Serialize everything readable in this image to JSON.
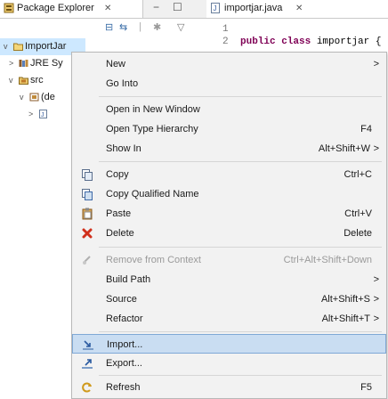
{
  "tabs": {
    "package_explorer": "Package Explorer",
    "close": "✕",
    "minimize": "−",
    "maximize": "☐",
    "editor_file": "importjar.java",
    "editor_close": "✕"
  },
  "view_toolbar": {
    "collapse": "⊟",
    "link": "⇆",
    "separator": "|",
    "focus": "✱",
    "dropdown": "▽"
  },
  "tree": [
    {
      "twisty": "v",
      "label": "ImportJar"
    },
    {
      "twisty": ">",
      "label": "JRE Sy"
    },
    {
      "twisty": "v",
      "label": "src"
    },
    {
      "twisty": "v",
      "label": "(de"
    },
    {
      "twisty": ">",
      "label": ""
    }
  ],
  "editor": {
    "lines": [
      {
        "num": "1",
        "code": ""
      },
      {
        "num": "2",
        "keyword": "public class",
        "rest": " importjar {"
      }
    ]
  },
  "menu": {
    "items": [
      {
        "label": "New",
        "accel": "",
        "submenu": true,
        "disabled": false,
        "icon": ""
      },
      {
        "label": "Go Into",
        "accel": "",
        "submenu": false,
        "disabled": false,
        "icon": ""
      },
      {
        "label": "Open in New Window",
        "accel": "",
        "submenu": false,
        "disabled": false,
        "icon": ""
      },
      {
        "label": "Open Type Hierarchy",
        "accel": "F4",
        "submenu": false,
        "disabled": false,
        "icon": ""
      },
      {
        "label": "Show In",
        "accel": "Alt+Shift+W",
        "submenu": true,
        "disabled": false,
        "icon": ""
      },
      {
        "label": "Copy",
        "accel": "Ctrl+C",
        "submenu": false,
        "disabled": false,
        "icon": "copy-icon"
      },
      {
        "label": "Copy Qualified Name",
        "accel": "",
        "submenu": false,
        "disabled": false,
        "icon": "copy-qualified-name-icon"
      },
      {
        "label": "Paste",
        "accel": "Ctrl+V",
        "submenu": false,
        "disabled": false,
        "icon": "paste-icon"
      },
      {
        "label": "Delete",
        "accel": "Delete",
        "submenu": false,
        "disabled": false,
        "icon": "delete-icon"
      },
      {
        "label": "Remove from Context",
        "accel": "Ctrl+Alt+Shift+Down",
        "submenu": false,
        "disabled": true,
        "icon": "remove-from-context-icon"
      },
      {
        "label": "Build Path",
        "accel": "",
        "submenu": true,
        "disabled": false,
        "icon": ""
      },
      {
        "label": "Source",
        "accel": "Alt+Shift+S",
        "submenu": true,
        "disabled": false,
        "icon": ""
      },
      {
        "label": "Refactor",
        "accel": "Alt+Shift+T",
        "submenu": true,
        "disabled": false,
        "icon": ""
      },
      {
        "label": "Import...",
        "accel": "",
        "submenu": false,
        "disabled": false,
        "icon": "import-icon",
        "highlighted": true
      },
      {
        "label": "Export...",
        "accel": "",
        "submenu": false,
        "disabled": false,
        "icon": "export-icon"
      },
      {
        "label": "Refresh",
        "accel": "F5",
        "submenu": false,
        "disabled": false,
        "icon": "refresh-icon"
      }
    ],
    "submenu_arrow": ">"
  },
  "colors": {
    "selection": "#cde8ff",
    "menu_highlight": "#c9ddf2",
    "keyword": "#7f0055"
  }
}
